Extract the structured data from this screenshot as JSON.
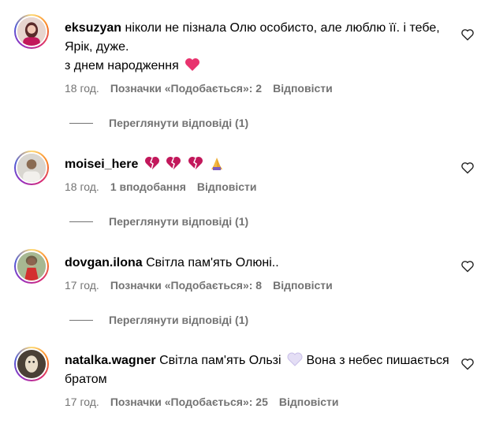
{
  "comments": [
    {
      "username": "eksuzyan",
      "text": "ніколи не пізнала Олю особисто, але люблю її. і тебе, Ярік, дуже.",
      "text2": "з днем народження",
      "time": "18 год.",
      "likes": "Позначки «Подобається»: 2",
      "reply": "Відповісти",
      "view_replies": "Переглянути відповіді (1)",
      "emojis": [
        "pink-heart"
      ]
    },
    {
      "username": "moisei_here",
      "text": "",
      "time": "18 год.",
      "likes": "1 вподобання",
      "reply": "Відповісти",
      "view_replies": "Переглянути відповіді (1)",
      "emojis": [
        "broken-heart",
        "broken-heart",
        "broken-heart",
        "praying-hands"
      ]
    },
    {
      "username": "dovgan.ilona",
      "text": "Світла пам'ять Олюні..",
      "time": "17 год.",
      "likes": "Позначки «Подобається»: 8",
      "reply": "Відповісти",
      "view_replies": "Переглянути відповіді (1)"
    },
    {
      "username": "natalka.wagner",
      "text": "Світла пам'ять Ользі",
      "text_after": "Вона з небес пишається братом",
      "time": "17 год.",
      "likes": "Позначки «Подобається»: 25",
      "reply": "Відповісти",
      "emojis": [
        "white-heart"
      ]
    }
  ],
  "colors": {
    "meta": "#737373",
    "text": "#000000",
    "pink_heart": "#e8336e",
    "broken_heart": "#c2185b",
    "white_heart": "#d9d2f2"
  }
}
